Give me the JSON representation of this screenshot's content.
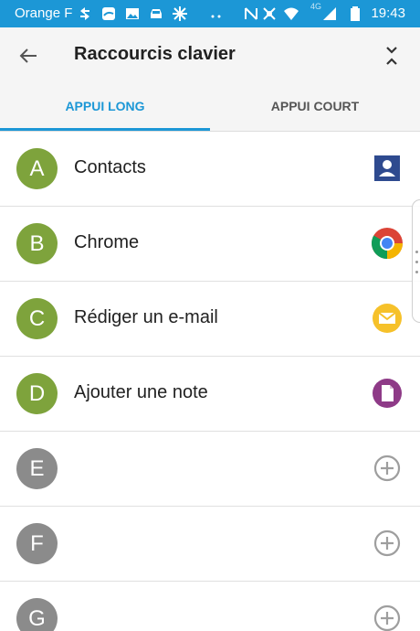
{
  "status_bar": {
    "carrier": "Orange F",
    "network_label": "4G",
    "time": "19:43",
    "color": "#1c97d6"
  },
  "header": {
    "title": "Raccourcis clavier"
  },
  "tabs": [
    {
      "label": "APPUI LONG",
      "active": true
    },
    {
      "label": "APPUI COURT",
      "active": false
    }
  ],
  "shortcuts": [
    {
      "letter": "A",
      "label": "Contacts",
      "icon": "contacts-icon"
    },
    {
      "letter": "B",
      "label": "Chrome",
      "icon": "chrome-icon"
    },
    {
      "letter": "C",
      "label": "Rédiger un e-mail",
      "icon": "email-icon"
    },
    {
      "letter": "D",
      "label": "Ajouter une note",
      "icon": "note-icon"
    },
    {
      "letter": "E",
      "label": "",
      "icon": "add-icon"
    },
    {
      "letter": "F",
      "label": "",
      "icon": "add-icon"
    },
    {
      "letter": "G",
      "label": "",
      "icon": "add-icon"
    }
  ],
  "colors": {
    "accent": "#1c97d6",
    "assigned_avatar": "#7ea33c",
    "empty_avatar": "#8b8b8b"
  }
}
